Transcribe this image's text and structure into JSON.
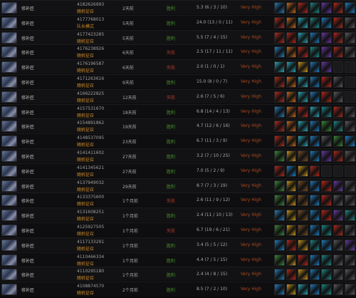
{
  "item_colors": {
    "blue": "#1e7fc4",
    "red": "#b8281c",
    "gold": "#c8961e",
    "purple": "#6a3aa8",
    "cyan": "#2aa8b8",
    "green": "#3a8a3a",
    "orange": "#c86a1e",
    "grey": "#5a5a62",
    "teal": "#1e8a8a",
    "brown": "#7a5028",
    "empty": "#1a1a1c"
  },
  "matches": [
    {
      "hero": "修补匠",
      "match_id": "4182626993",
      "mode": "随机征召",
      "time": "2天前",
      "result": "胜利",
      "result_type": "win",
      "kda": "5.3 (6 / 3 / 10)",
      "skill": "Very High",
      "items": [
        "blue",
        "orange",
        "red",
        "teal",
        "purple",
        "red",
        "blue"
      ]
    },
    {
      "hero": "修补匠",
      "match_id": "4177768013",
      "mode": "队长模式",
      "time": "5天前",
      "result": "胜利",
      "result_type": "win",
      "kda": "24.0 (13 / 0 / 11)",
      "skill": "Very High",
      "items": [
        "red",
        "orange",
        "cyan",
        "teal",
        "blue",
        "red",
        "grey"
      ]
    },
    {
      "hero": "修补匠",
      "match_id": "4177423285",
      "mode": "随机征召",
      "time": "5天前",
      "result": "胜利",
      "result_type": "win",
      "kda": "5.5 (7 / 4 / 15)",
      "skill": "Very High",
      "items": [
        "red",
        "red",
        "cyan",
        "blue",
        "purple",
        "red",
        "grey"
      ]
    },
    {
      "hero": "修补匠",
      "match_id": "4176238926",
      "mode": "随机征召",
      "time": "6天前",
      "result": "失败",
      "result_type": "loss",
      "kda": "2.5 (17 / 11 / 11)",
      "skill": "Very High",
      "items": [
        "blue",
        "orange",
        "red",
        "teal",
        "purple",
        "red",
        "grey"
      ]
    },
    {
      "hero": "修补匠",
      "match_id": "4176196587",
      "mode": "随机征召",
      "time": "6天前",
      "result": "失败",
      "result_type": "loss",
      "kda": "2.0 (1 / 0 / 1)",
      "skill": "Very High",
      "items": [
        "cyan",
        "cyan",
        "gold",
        "blue",
        "purple",
        "empty",
        "empty"
      ]
    },
    {
      "hero": "修补匠",
      "match_id": "4171263616",
      "mode": "随机征召",
      "time": "9天前",
      "result": "胜利",
      "result_type": "win",
      "kda": "15.0 (8 / 0 / 7)",
      "skill": "Very High",
      "items": [
        "red",
        "orange",
        "cyan",
        "blue",
        "red",
        "grey",
        "empty"
      ]
    },
    {
      "hero": "修补匠",
      "match_id": "4166222825",
      "mode": "随机征召",
      "time": "12天前",
      "result": "失败",
      "result_type": "loss",
      "kda": "2.6 (7 / 5 / 6)",
      "skill": "Very High",
      "items": [
        "red",
        "orange",
        "cyan",
        "blue",
        "red",
        "grey",
        "empty"
      ]
    },
    {
      "hero": "修补匠",
      "match_id": "4157531670",
      "mode": "随机征召",
      "time": "18天前",
      "result": "胜利",
      "result_type": "win",
      "kda": "6.8 (14 / 4 / 13)",
      "skill": "Very High",
      "items": [
        "blue",
        "orange",
        "red",
        "cyan",
        "teal",
        "red",
        "grey"
      ]
    },
    {
      "hero": "修补匠",
      "match_id": "4154891862",
      "mode": "随机征召",
      "time": "19天前",
      "result": "胜利",
      "result_type": "win",
      "kda": "4.7 (12 / 6 / 16)",
      "skill": "Very High",
      "items": [
        "red",
        "orange",
        "cyan",
        "blue",
        "green",
        "teal",
        "grey"
      ]
    },
    {
      "hero": "修补匠",
      "match_id": "4148537095",
      "mode": "随机征召",
      "time": "23天前",
      "result": "胜利",
      "result_type": "win",
      "kda": "6.7 (11 / 3 / 9)",
      "skill": "Very High",
      "items": [
        "red",
        "orange",
        "cyan",
        "blue",
        "grey",
        "green",
        "blue"
      ]
    },
    {
      "hero": "修补匠",
      "match_id": "4141411602",
      "mode": "随机征召",
      "time": "27天前",
      "result": "胜利",
      "result_type": "win",
      "kda": "3.2 (7 / 10 / 25)",
      "skill": "Very High",
      "items": [
        "green",
        "gold",
        "brown",
        "blue",
        "purple",
        "red",
        "grey"
      ]
    },
    {
      "hero": "修补匠",
      "match_id": "4141345621",
      "mode": "随机征召",
      "time": "27天前",
      "result": "胜利",
      "result_type": "win",
      "kda": "7.0 (5 / 2 / 9)",
      "skill": "Very High",
      "items": [
        "red",
        "blue",
        "gold",
        "red",
        "empty",
        "empty",
        "empty"
      ]
    },
    {
      "hero": "修补匠",
      "match_id": "4137949032",
      "mode": "随机征召",
      "time": "29天前",
      "result": "胜利",
      "result_type": "win",
      "kda": "8.7 (7 / 3 / 19)",
      "skill": "Very High",
      "items": [
        "green",
        "gold",
        "brown",
        "blue",
        "red",
        "purple",
        "grey"
      ]
    },
    {
      "hero": "修补匠",
      "match_id": "4133375600",
      "mode": "随机征召",
      "time": "1个月前",
      "result": "失败",
      "result_type": "loss",
      "kda": "2.6 (11 / 9 / 12)",
      "skill": "Very High",
      "items": [
        "green",
        "gold",
        "brown",
        "blue",
        "red",
        "grey",
        "grey"
      ]
    },
    {
      "hero": "修补匠",
      "match_id": "4131608251",
      "mode": "随机征召",
      "time": "1个月前",
      "result": "胜利",
      "result_type": "win",
      "kda": "2.4 (11 / 10 / 13)",
      "skill": "Very High",
      "items": [
        "blue",
        "gold",
        "brown",
        "blue",
        "red",
        "purple",
        "teal"
      ]
    },
    {
      "hero": "修补匠",
      "match_id": "4125927505",
      "mode": "随机征召",
      "time": "1个月前",
      "result": "失败",
      "result_type": "loss",
      "kda": "6.7 (19 / 6 / 21)",
      "skill": "Very High",
      "items": [
        "green",
        "gold",
        "brown",
        "blue",
        "teal",
        "red",
        "grey"
      ]
    },
    {
      "hero": "修补匠",
      "match_id": "4117133291",
      "mode": "随机征召",
      "time": "1个月前",
      "result": "胜利",
      "result_type": "win",
      "kda": "3.4 (5 / 5 / 12)",
      "skill": "Very High",
      "items": [
        "blue",
        "red",
        "gold",
        "teal",
        "blue",
        "grey",
        "purple"
      ]
    },
    {
      "hero": "修补匠",
      "match_id": "4110466334",
      "mode": "随机征召",
      "time": "1个月前",
      "result": "胜利",
      "result_type": "win",
      "kda": "4.4 (7 / 5 / 15)",
      "skill": "Very High",
      "items": [
        "green",
        "gold",
        "red",
        "blue",
        "teal",
        "grey",
        "grey"
      ]
    },
    {
      "hero": "修补匠",
      "match_id": "4110295180",
      "mode": "随机征召",
      "time": "1个月前",
      "result": "胜利",
      "result_type": "win",
      "kda": "2.4 (4 / 8 / 15)",
      "skill": "Very High",
      "items": [
        "blue",
        "red",
        "gold",
        "blue",
        "teal",
        "grey",
        "grey"
      ]
    },
    {
      "hero": "修补匠",
      "match_id": "4108874570",
      "mode": "随机征召",
      "time": "2个月前",
      "result": "胜利",
      "result_type": "win",
      "kda": "8.5 (7 / 2 / 10)",
      "skill": "Very High",
      "items": [
        "blue",
        "gold",
        "cyan",
        "blue",
        "teal",
        "grey",
        "grey"
      ]
    }
  ]
}
